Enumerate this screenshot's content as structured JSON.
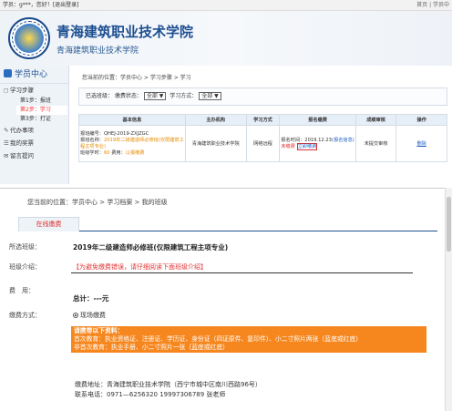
{
  "topbar": {
    "left_prefix": "学员：g***，您好！",
    "logout": "[退出登录]",
    "right": "首页 | 学员中"
  },
  "header": {
    "school_name": "青海建筑职业技术学院",
    "school_sub": "青海建筑职业技术学院"
  },
  "sidebar": {
    "title": "学员中心",
    "items": [
      {
        "label": "学习步骤",
        "subs": [
          {
            "label": "第1步：报班",
            "active": false
          },
          {
            "label": "第2步：学习",
            "active": true
          },
          {
            "label": "第3步：打证",
            "active": false
          }
        ]
      },
      {
        "label": "代办事项"
      },
      {
        "label": "我的奖票"
      },
      {
        "label": "留言提问"
      }
    ]
  },
  "panel": {
    "crumb": "您当前的位置：学员中心 > 学习步骤 > 学习",
    "filter_prefix": "已选班级：",
    "pay_status_label": "缴费状态：",
    "pay_status_value": "全部",
    "study_mode_label": "学习方式：",
    "study_mode_value": "全部",
    "table": {
      "headers": [
        "基本信息",
        "主办机构",
        "学习方式",
        "报名缴费",
        "成绩审核",
        "操作"
      ],
      "row": {
        "info_line1": "报班编号：QHEJ-2019-ZXJZGC",
        "info_line2_prefix": "报班名称：",
        "info_line2_link": "2019年二级建造师必修班(仅限建筑工程主项专业)",
        "info_line3_prefix": "班级学时：",
        "info_line3_hours": "60",
        "info_line3_mid": " 费用：",
        "info_line3_fee": "以报缴费",
        "org": "青海建筑职业技术学院",
        "mode": "网络远程",
        "apply_time_prefix": "报名时间：2019.12.23",
        "apply_link": "(报名信息)",
        "unpaid": "未缴费",
        "pay_now": "立即缴费",
        "review": "未提交审核",
        "action": "删除"
      }
    }
  },
  "modal": {
    "crumb": "您当前的位置：学员中心 > 学习档案 > 我的班级",
    "tab": "在线缴费",
    "class_label": "所选班级：",
    "class_value": "2019年二级建造师必修班(仅限建筑工程主项专业)",
    "intro_label": "班级介绍：",
    "intro_value": "【为避免缴费错误，请仔细阅读下面班级介绍】",
    "fee_label": "费　用：",
    "fee_value": "总计：---元",
    "pay_label": "缴费方式：",
    "pay_option": "现场缴费",
    "notice_head": "请携带以下资料：",
    "notice_line1": "首次教育：执业资格证、注册证、学历证、身份证（四证原件、复印件）、小二寸照片两张（蓝底或红底）",
    "notice_line2": "非首次教育：执业手册、小二寸照片一张（蓝底或红底）",
    "address": "缴费地址：青海建筑职业技术学院（西宁市城中区南川西路96号）",
    "phone": "联系电话：0971—6256320 19997306789 张老师"
  }
}
